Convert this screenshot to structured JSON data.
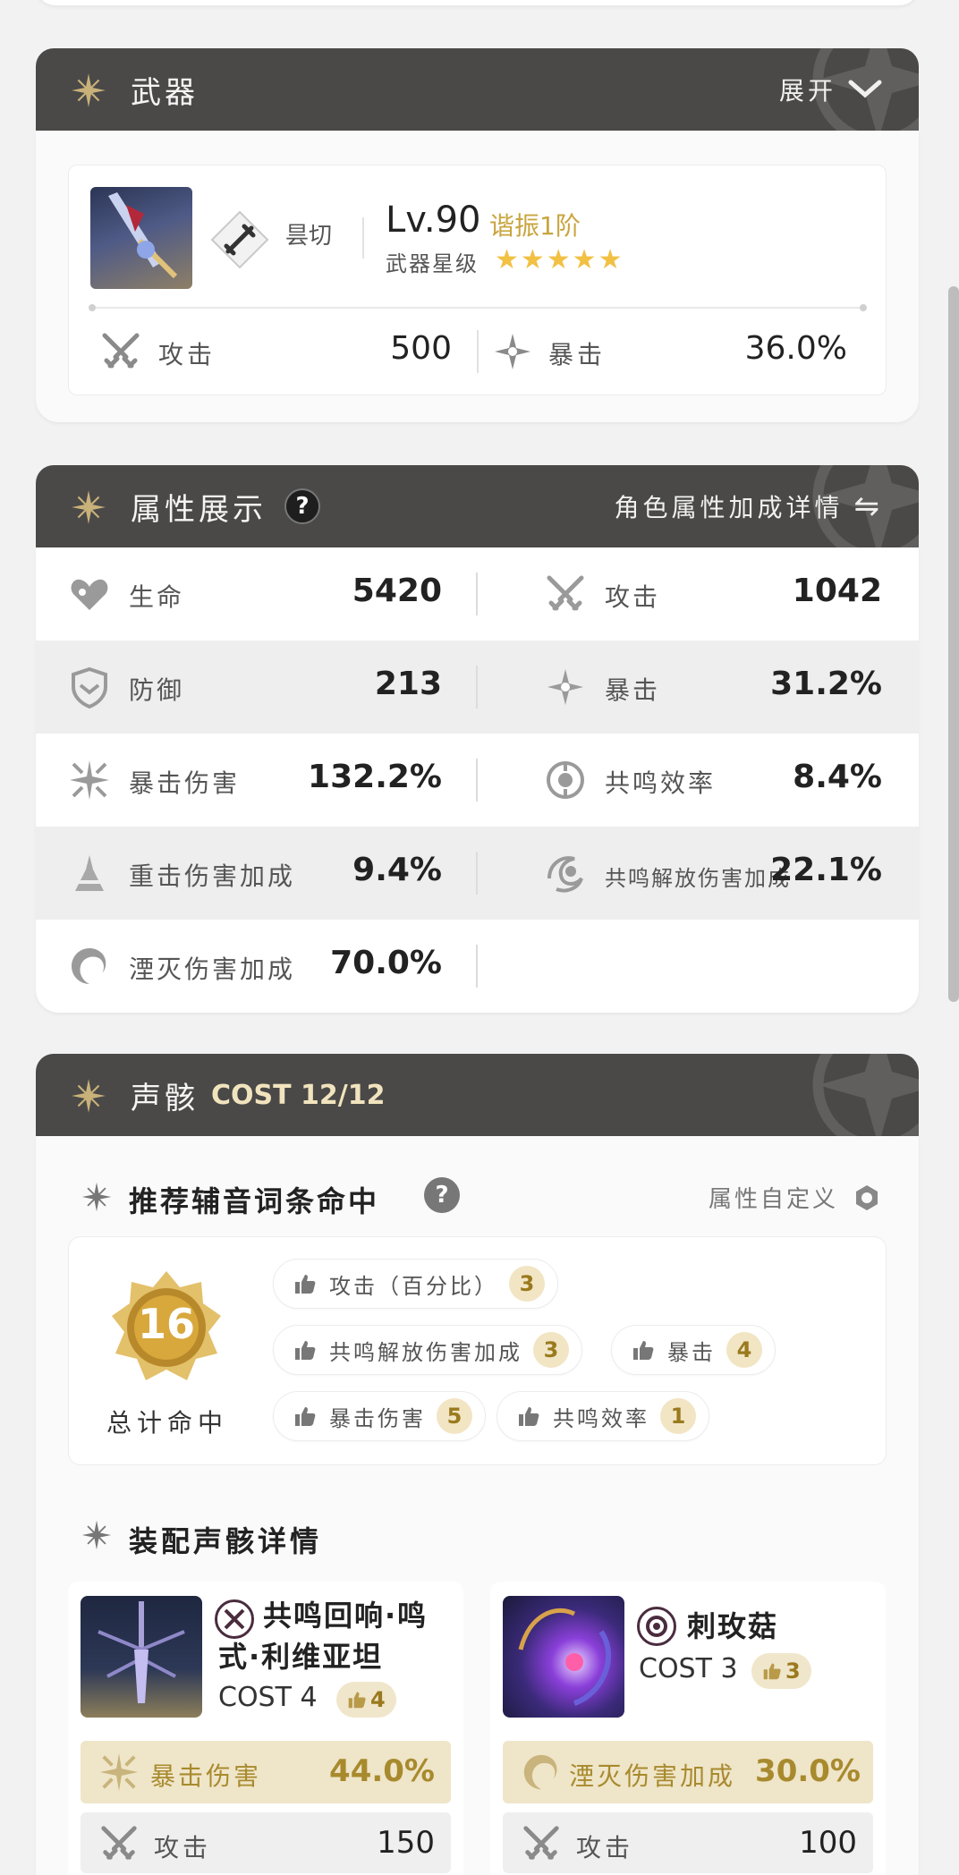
{
  "weapon_section": {
    "title": "武器",
    "expand_label": "展开",
    "weapon": {
      "type": "昙切",
      "level": "Lv.90",
      "rank": "谐振1阶",
      "star_label": "武器星级",
      "stars": "★★★★★",
      "stats": [
        {
          "label": "攻击",
          "value": "500"
        },
        {
          "label": "暴击",
          "value": "36.0%"
        }
      ]
    }
  },
  "attr_section": {
    "title": "属性展示",
    "help": "?",
    "detail_label": "角色属性加成详情",
    "swap_icon": "⇋",
    "rows": [
      [
        {
          "label": "生命",
          "value": "5420",
          "icon": "heart-icon"
        },
        {
          "label": "攻击",
          "value": "1042",
          "icon": "swords-icon"
        }
      ],
      [
        {
          "label": "防御",
          "value": "213",
          "icon": "shield-icon"
        },
        {
          "label": "暴击",
          "value": "31.2%",
          "icon": "crit-star-icon"
        }
      ],
      [
        {
          "label": "暴击伤害",
          "value": "132.2%",
          "icon": "crit-damage-icon"
        },
        {
          "label": "共鸣效率",
          "value": "8.4%",
          "icon": "energy-icon"
        }
      ],
      [
        {
          "label": "重击伤害加成",
          "value": "9.4%",
          "icon": "heavy-attack-icon"
        },
        {
          "label": "共鸣解放伤害加成",
          "value": "22.1%",
          "icon": "liberation-icon"
        }
      ],
      [
        {
          "label": "湮灭伤害加成",
          "value": "70.0%",
          "icon": "havoc-icon"
        }
      ]
    ]
  },
  "echo_section": {
    "title": "声骸",
    "cost": "COST 12/12",
    "recommend": {
      "title": "推荐辅音词条命中",
      "help": "?",
      "custom_label": "属性自定义",
      "total_hits": "16",
      "total_label": "总计命中",
      "chips": [
        {
          "label": "攻击（百分比）",
          "count": "3"
        },
        {
          "label": "共鸣解放伤害加成",
          "count": "3"
        },
        {
          "label": "暴击",
          "count": "4"
        },
        {
          "label": "暴击伤害",
          "count": "5"
        },
        {
          "label": "共鸣效率",
          "count": "1"
        }
      ]
    },
    "equip_title": "装配声骸详情",
    "echoes": [
      {
        "name_line1": "共鸣回响·鸣",
        "name_line2": "式·利维亚坦",
        "cost": "COST 4",
        "hits": "4",
        "main": {
          "label": "暴击伤害",
          "value": "44.0%"
        },
        "sub": {
          "label": "攻击",
          "value": "150"
        }
      },
      {
        "name_line1": "刺玫菇",
        "cost": "COST 3",
        "hits": "3",
        "main": {
          "label": "湮灭伤害加成",
          "value": "30.0%"
        },
        "sub": {
          "label": "攻击",
          "value": "100"
        }
      }
    ]
  },
  "colors": {
    "header_bg": "#4a4948",
    "gold": "#c8a640",
    "star": "#f2c043",
    "main_stat_bg": "#efe5c8"
  }
}
